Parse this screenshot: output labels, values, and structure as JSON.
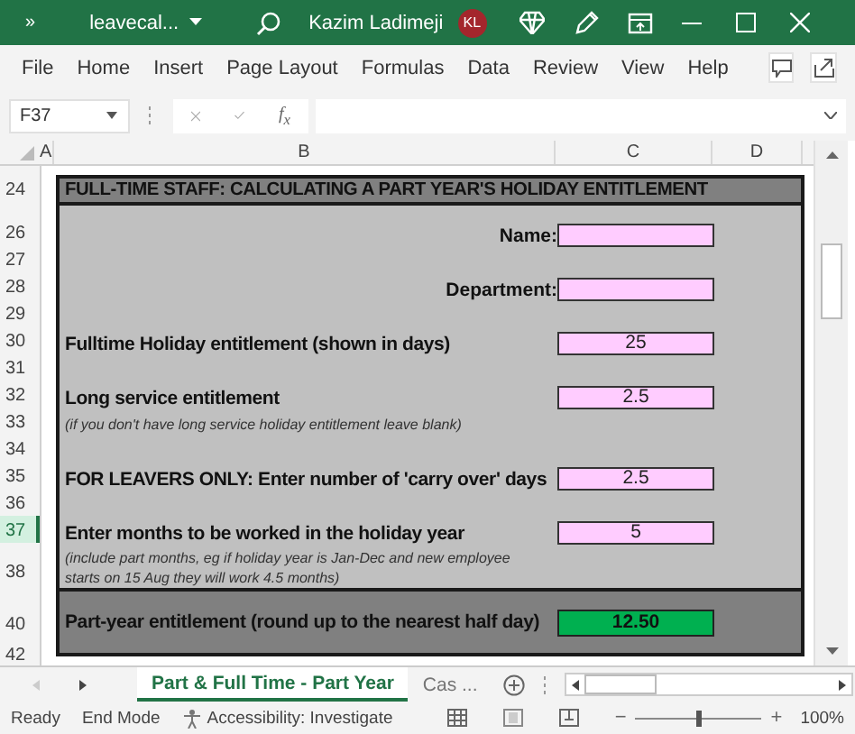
{
  "title_bar": {
    "quick_access": "»",
    "file_name": "leavecal...",
    "user_name": "Kazim Ladimeji",
    "user_initials": "KL"
  },
  "menu": [
    {
      "label": "File"
    },
    {
      "label": "Home"
    },
    {
      "label": "Insert"
    },
    {
      "label": "Page Layout"
    },
    {
      "label": "Formulas"
    },
    {
      "label": "Data"
    },
    {
      "label": "Review"
    },
    {
      "label": "View"
    },
    {
      "label": "Help"
    }
  ],
  "formula_bar": {
    "name_box": "F37",
    "function_label": "f$_{x}$"
  },
  "columns": [
    "A",
    "B",
    "C",
    "D"
  ],
  "rows": [
    {
      "kind": "header",
      "number": "24",
      "selected": false,
      "label": "FULL-TIME STAFF: CALCULATING A PART YEAR'S HOLIDAY ENTITLEMENT"
    },
    {
      "kind": "spacer"
    },
    {
      "kind": "field",
      "number": "26",
      "selected": false,
      "label": "Name:"
    },
    {
      "kind": "blank",
      "number": "27",
      "selected": false
    },
    {
      "kind": "field",
      "number": "28",
      "selected": false,
      "label": "Department:"
    },
    {
      "kind": "blank",
      "number": "29",
      "selected": false
    },
    {
      "kind": "input",
      "number": "30",
      "selected": false,
      "label": "Fulltime Holiday entitlement (shown in days)",
      "value": "25"
    },
    {
      "kind": "blank",
      "number": "31",
      "selected": false
    },
    {
      "kind": "input",
      "number": "32",
      "selected": false,
      "label": "Long service entitlement",
      "value": "2.5"
    },
    {
      "kind": "note",
      "number": "33",
      "selected": false,
      "label": "(if you don't have long service holiday entitlement leave blank)"
    },
    {
      "kind": "blank",
      "number": "34",
      "selected": false
    },
    {
      "kind": "input",
      "number": "35",
      "selected": false,
      "label": "FOR LEAVERS ONLY: Enter number of 'carry over' days",
      "value": "2.5"
    },
    {
      "kind": "blank",
      "number": "36",
      "selected": false
    },
    {
      "kind": "input",
      "number": "37",
      "selected": true,
      "label": "Enter months to be worked in the holiday year",
      "value": "5"
    },
    {
      "kind": "note",
      "number": "38",
      "selected": false,
      "label": "(include part months, eg if holiday year is Jan-Dec and new employee starts on 15 Aug  they will work 4.5 months)"
    },
    {
      "kind": "shade"
    },
    {
      "kind": "result",
      "number": "40",
      "selected": false,
      "label": "Part-year entitlement (round up to the nearest half day)",
      "value": "12.50"
    },
    {
      "kind": "shade"
    },
    {
      "kind": "outside",
      "number": "42",
      "selected": false
    }
  ],
  "sheet_tabs": [
    {
      "label": "Part & Full Time - Part Year",
      "selected": true
    },
    {
      "label": "Cas ...",
      "selected": false
    }
  ],
  "status_bar": {
    "mode": "Ready",
    "end_mode": "End Mode",
    "accessibility": "Accessibility: Investigate",
    "zoom": {
      "minus": "−",
      "plus": "+",
      "level": 0.5,
      "reading": "100%"
    }
  }
}
